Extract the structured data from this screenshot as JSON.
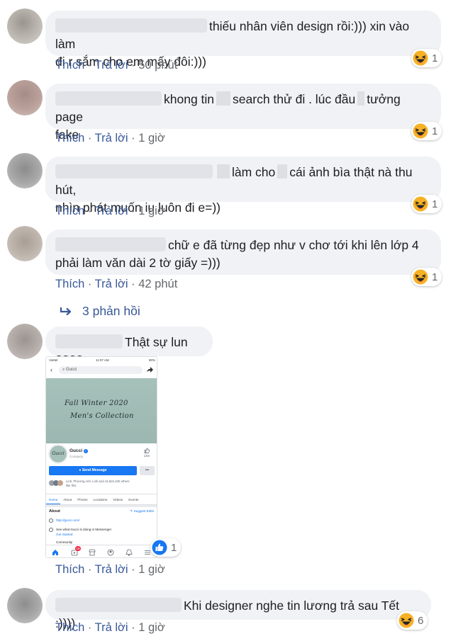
{
  "actions": {
    "like": "Thích",
    "reply": "Trả lời",
    "sep": "·"
  },
  "colors": {
    "link": "#385898",
    "muted": "#65676b",
    "bubble": "#f0f2f5",
    "fb_blue": "#1877f2",
    "haha_yellow": "#f7b125"
  },
  "comments": [
    {
      "text_l1": "thiếu nhân viên design rồi:))) xin vào làm",
      "text_l2": "đi r sắm cho em mấy đôi:)))",
      "time": "50 phút",
      "reaction": {
        "icon": "haha-emoji-icon",
        "count": "1"
      }
    },
    {
      "text_a": "khong tin",
      "text_b": "search thử đi . lúc đầu",
      "text_c": "tưởng page",
      "text_l2": "fake",
      "time": "1 giờ",
      "reaction": {
        "icon": "haha-emoji-icon",
        "count": "1"
      }
    },
    {
      "text_a": "làm cho",
      "text_b": "cái ảnh bìa thật nà thu hút,",
      "text_l2": "nhìn phát muốn iu luôn đi e=))",
      "time": "1 giờ",
      "reaction": {
        "icon": "haha-emoji-icon",
        "count": "1"
      }
    },
    {
      "text_l1": "chữ e đã từng đẹp như v chơ tới khi lên lớp 4",
      "text_l2": "phải làm văn dài 2 tờ giấy =)))",
      "time": "42 phút",
      "reaction": {
        "icon": "haha-emoji-icon",
        "count": "1"
      }
    },
    {
      "text_l1": "Thật sự lun ????",
      "time": "1 giờ",
      "reaction": {
        "icon": "like-thumb-icon",
        "count": "1"
      }
    },
    {
      "text_l1": "Khi designer nghe tin lương trả sau Tết :))))",
      "time": "1 giờ",
      "reaction": {
        "icon": "haha-emoji-icon",
        "count": "6"
      }
    }
  ],
  "replies_link": "3 phản hồi",
  "screenshot": {
    "status_carrier": "Viettel",
    "status_time": "11:07 AM",
    "status_battery": "80%",
    "search_text": "Gucci",
    "cover_line1": "Fall Winter 2020",
    "cover_line2": "Men's Collection",
    "logo_text": "Gucci",
    "page_name": "Gucci",
    "page_category": "Company",
    "like_label": "Like",
    "send_message": "Send Message",
    "more_dots": "•••",
    "friends_line1": "Linh, Phương Anh, Linh and 16,822,400 others",
    "friends_line2": "like this.",
    "tabs": [
      "Home",
      "About",
      "Photos",
      "Locations",
      "Videos",
      "Events"
    ],
    "about_title": "About",
    "suggest_edits": "Suggest Edits",
    "website": "http://gucci.com/",
    "messenger_text": "See what Gucci is doing in Messenger",
    "get_started": "Get Started",
    "community_label": "Community",
    "notif_badge": "19"
  }
}
